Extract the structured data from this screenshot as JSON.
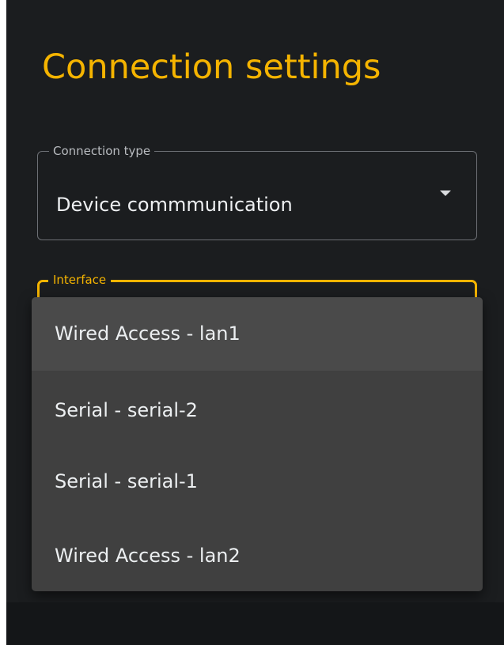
{
  "title": "Connection settings",
  "connection_type": {
    "label": "Connection type",
    "value": "Device commmunication"
  },
  "interface": {
    "label": "Interface",
    "options": [
      "Wired Access - lan1",
      "Serial - serial-2",
      "Serial - serial-1",
      "Wired Access - lan2"
    ],
    "highlighted_index": 0
  },
  "colors": {
    "accent": "#f5b400",
    "background": "#1b1d1f",
    "menu": "#404040"
  }
}
